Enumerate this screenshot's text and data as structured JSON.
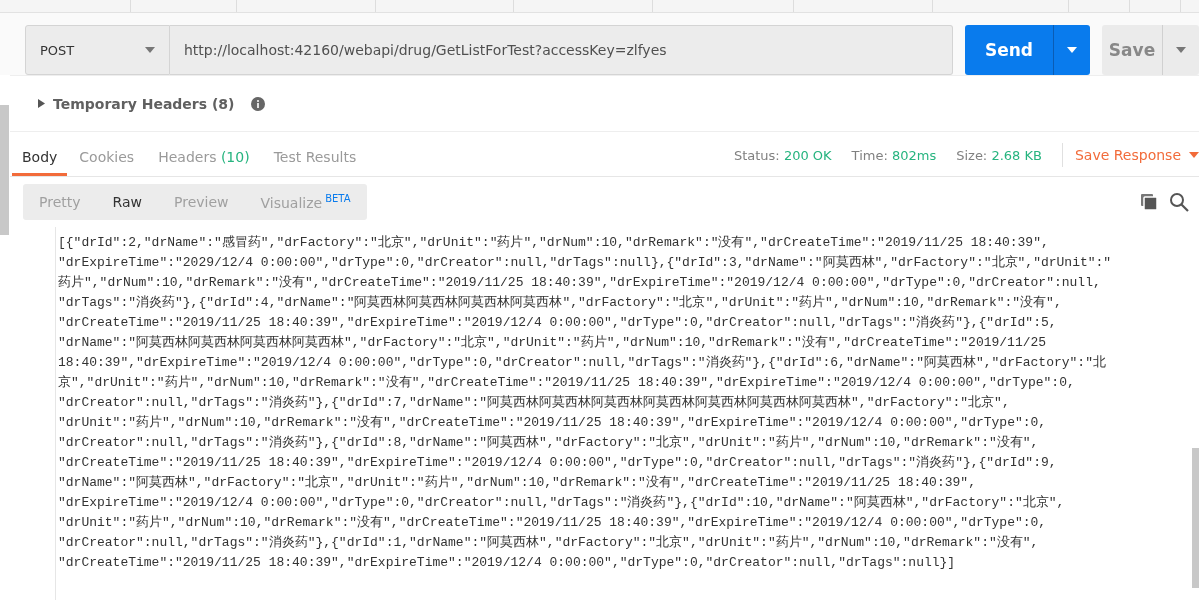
{
  "request": {
    "method": "POST",
    "url": "http://localhost:42160/webapi/drug/GetListForTest?accessKey=zlfyes",
    "send": "Send",
    "save": "Save"
  },
  "temporary_headers": {
    "label": "Temporary Headers",
    "count": "(8)",
    "expanded": false
  },
  "response_tabs": [
    {
      "label": "Body",
      "selected": true
    },
    {
      "label": "Cookies",
      "selected": false
    },
    {
      "label": "Headers",
      "count": "(10)",
      "selected": false
    },
    {
      "label": "Test Results",
      "selected": false
    }
  ],
  "response_meta": [
    {
      "label": "Status:",
      "value": "200 OK"
    },
    {
      "label": "Time:",
      "value": "802ms"
    },
    {
      "label": "Size:",
      "value": "2.68 KB"
    }
  ],
  "save_response": "Save Response",
  "view_modes": [
    {
      "label": "Pretty",
      "selected": false
    },
    {
      "label": "Raw",
      "selected": true
    },
    {
      "label": "Preview",
      "selected": false
    },
    {
      "label": "Visualize",
      "badge": "BETA",
      "selected": false
    }
  ],
  "body_lines": [
    "[{\"drId\":2,\"drName\":\"感冒药\",\"drFactory\":\"北京\",\"drUnit\":\"药片\",\"drNum\":10,\"drRemark\":\"没有\",\"drCreateTime\":\"2019/11/25 18:40:39\",",
    "\"drExpireTime\":\"2029/12/4 0:00:00\",\"drType\":0,\"drCreator\":null,\"drTags\":null},{\"drId\":3,\"drName\":\"阿莫西林\",\"drFactory\":\"北京\",\"drUnit\":\"",
    "药片\",\"drNum\":10,\"drRemark\":\"没有\",\"drCreateTime\":\"2019/11/25 18:40:39\",\"drExpireTime\":\"2019/12/4 0:00:00\",\"drType\":0,\"drCreator\":null,",
    "\"drTags\":\"消炎药\"},{\"drId\":4,\"drName\":\"阿莫西林阿莫西林阿莫西林阿莫西林\",\"drFactory\":\"北京\",\"drUnit\":\"药片\",\"drNum\":10,\"drRemark\":\"没有\",",
    "\"drCreateTime\":\"2019/11/25 18:40:39\",\"drExpireTime\":\"2019/12/4 0:00:00\",\"drType\":0,\"drCreator\":null,\"drTags\":\"消炎药\"},{\"drId\":5,",
    "\"drName\":\"阿莫西林阿莫西林阿莫西林阿莫西林\",\"drFactory\":\"北京\",\"drUnit\":\"药片\",\"drNum\":10,\"drRemark\":\"没有\",\"drCreateTime\":\"2019/11/25",
    "18:40:39\",\"drExpireTime\":\"2019/12/4 0:00:00\",\"drType\":0,\"drCreator\":null,\"drTags\":\"消炎药\"},{\"drId\":6,\"drName\":\"阿莫西林\",\"drFactory\":\"北",
    "京\",\"drUnit\":\"药片\",\"drNum\":10,\"drRemark\":\"没有\",\"drCreateTime\":\"2019/11/25 18:40:39\",\"drExpireTime\":\"2019/12/4 0:00:00\",\"drType\":0,",
    "\"drCreator\":null,\"drTags\":\"消炎药\"},{\"drId\":7,\"drName\":\"阿莫西林阿莫西林阿莫西林阿莫西林阿莫西林阿莫西林阿莫西林\",\"drFactory\":\"北京\",",
    "\"drUnit\":\"药片\",\"drNum\":10,\"drRemark\":\"没有\",\"drCreateTime\":\"2019/11/25 18:40:39\",\"drExpireTime\":\"2019/12/4 0:00:00\",\"drType\":0,",
    "\"drCreator\":null,\"drTags\":\"消炎药\"},{\"drId\":8,\"drName\":\"阿莫西林\",\"drFactory\":\"北京\",\"drUnit\":\"药片\",\"drNum\":10,\"drRemark\":\"没有\",",
    "\"drCreateTime\":\"2019/11/25 18:40:39\",\"drExpireTime\":\"2019/12/4 0:00:00\",\"drType\":0,\"drCreator\":null,\"drTags\":\"消炎药\"},{\"drId\":9,",
    "\"drName\":\"阿莫西林\",\"drFactory\":\"北京\",\"drUnit\":\"药片\",\"drNum\":10,\"drRemark\":\"没有\",\"drCreateTime\":\"2019/11/25 18:40:39\",",
    "\"drExpireTime\":\"2019/12/4 0:00:00\",\"drType\":0,\"drCreator\":null,\"drTags\":\"消炎药\"},{\"drId\":10,\"drName\":\"阿莫西林\",\"drFactory\":\"北京\",",
    "\"drUnit\":\"药片\",\"drNum\":10,\"drRemark\":\"没有\",\"drCreateTime\":\"2019/11/25 18:40:39\",\"drExpireTime\":\"2019/12/4 0:00:00\",\"drType\":0,",
    "\"drCreator\":null,\"drTags\":\"消炎药\"},{\"drId\":1,\"drName\":\"阿莫西林\",\"drFactory\":\"北京\",\"drUnit\":\"药片\",\"drNum\":10,\"drRemark\":\"没有\",",
    "\"drCreateTime\":\"2019/11/25 18:40:39\",\"drExpireTime\":\"2019/12/4 0:00:00\",\"drType\":0,\"drCreator\":null,\"drTags\":null}]"
  ]
}
